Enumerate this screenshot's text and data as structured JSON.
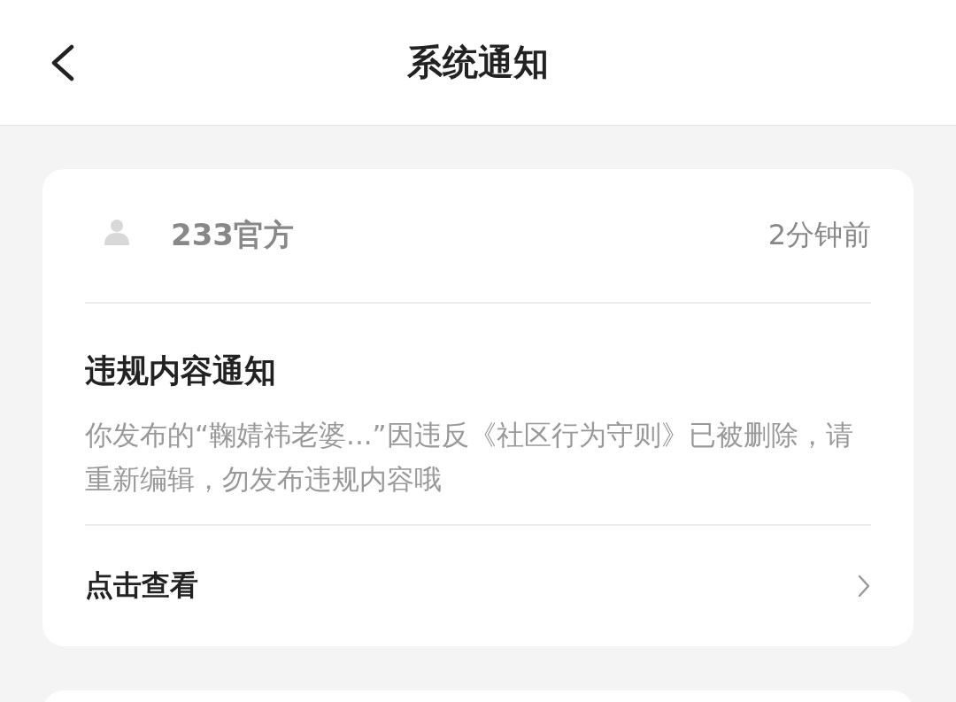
{
  "header": {
    "title": "系统通知"
  },
  "notifications": [
    {
      "sender": "233官方",
      "time": "2分钟前",
      "title": "违规内容通知",
      "body": "你发布的“鞠婧祎老婆...”因违反《社区行为守则》已被删除，请重新编辑，勿发布违规内容哦",
      "action": "点击查看"
    }
  ]
}
